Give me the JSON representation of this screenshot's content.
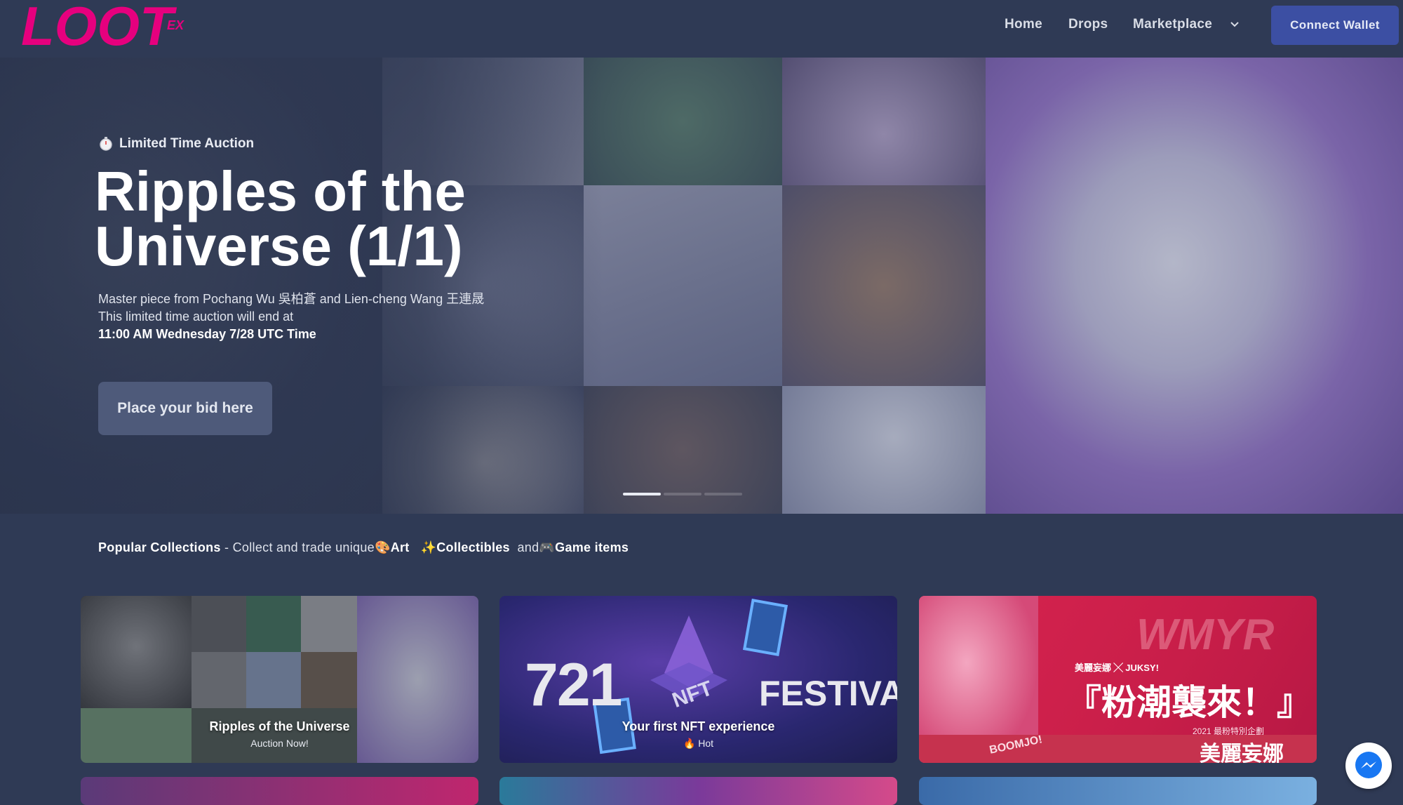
{
  "nav": {
    "logo_text": "LOOT",
    "logo_suffix": "EX",
    "links": [
      "Home",
      "Drops",
      "Marketplace"
    ],
    "wallet_label": "Connect Wallet"
  },
  "hero": {
    "badge": "Limited Time Auction",
    "title_line1": "Ripples of the",
    "title_line2": "Universe (1/1)",
    "desc_line1": "Master piece from Pochang Wu 吳柏蒼 and Lien-cheng Wang 王連晟",
    "desc_line2": "This limited time auction will end at",
    "desc_line3": "11:00 AM Wednesday 7/28 UTC Time",
    "bid_label": "Place your bid here"
  },
  "popular": {
    "heading": "Popular Collections",
    "text": " - Collect and trade unique",
    "art": "Art",
    "collectibles": "Collectibles",
    "and": "and",
    "game": "Game items"
  },
  "cards": [
    {
      "title": "Ripples of the Universe",
      "subtitle": "Auction Now!"
    },
    {
      "title": "Your first NFT experience",
      "subtitle": "Hot",
      "art_num": "721",
      "art_word": "FESTIVAL",
      "art_badge": "NFT"
    },
    {
      "art_title": "『粉潮襲來！』",
      "art_brand": "WMYR",
      "art_name": "美麗妄娜",
      "art_collab": "美麗妄娜 ╳ JUKSY!",
      "art_tag": "BOOMJO!",
      "art_sub": "2021 最粉特別企劃"
    }
  ],
  "colors": {
    "bg": "#2f3a55",
    "accent": "#e6007e",
    "button": "#3c4fa3"
  }
}
